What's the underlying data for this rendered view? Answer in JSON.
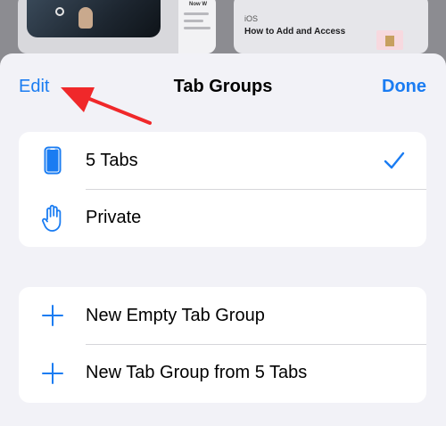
{
  "background": {
    "right_thumb": {
      "category": "iOS",
      "headline": "How to Add and Access"
    },
    "left_thumb": {
      "page_title": "Now W"
    }
  },
  "header": {
    "edit_label": "Edit",
    "title": "Tab Groups",
    "done_label": "Done"
  },
  "groups": [
    {
      "label": "5 Tabs",
      "icon": "iphone-icon",
      "selected": true
    },
    {
      "label": "Private",
      "icon": "hand-raised-icon",
      "selected": false
    }
  ],
  "actions": [
    {
      "label": "New Empty Tab Group",
      "icon": "plus-icon"
    },
    {
      "label": "New Tab Group from 5 Tabs",
      "icon": "plus-icon"
    }
  ],
  "colors": {
    "accent": "#1a7cf2",
    "annotation_arrow": "#f0282a",
    "sheet_background": "#f2f2f7"
  }
}
